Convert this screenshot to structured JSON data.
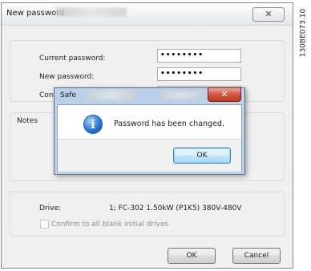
{
  "main_window": {
    "title": "New password",
    "close_glyph": "✕",
    "fields": [
      {
        "label": "Current password:",
        "value": "••••••••"
      },
      {
        "label": "New password:",
        "value": "••••••••"
      },
      {
        "label": "Confi",
        "value": ""
      }
    ],
    "notes_label": "Notes",
    "drive_label": "Drive:",
    "drive_value": "1; FC-302 1.50kW (P1K5) 380V-480V",
    "confirm_checkbox_label": "Confirm to all blank initial drives",
    "ok_label": "OK",
    "cancel_label": "Cancel"
  },
  "safe_dialog": {
    "title": "Safe",
    "close_glyph": "✕",
    "icon": "info-icon",
    "icon_glyph": "i",
    "message": "Password has been changed.",
    "ok_label": "OK"
  },
  "side_code": "130BE073.10",
  "colors": {
    "window_bg": "#f0f0f0",
    "dialog_frame": "#b9d1ea",
    "close_red": "#c23a1f",
    "info_blue": "#2c78d4"
  }
}
